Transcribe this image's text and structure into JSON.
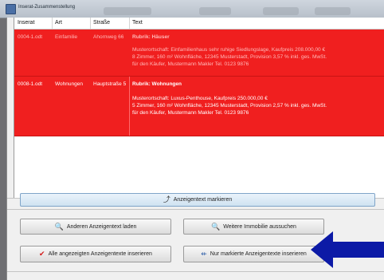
{
  "window": {
    "title": "Inserat-Zusammenstellung"
  },
  "grid": {
    "columns": [
      "Inserat",
      "Art",
      "Straße",
      "Text"
    ],
    "rows": [
      {
        "inserat": "0004-1.odt",
        "art": "Einfamilie",
        "strasse": "Ahornweg 66",
        "rubrik": "Rubrik: Häuser",
        "text_lines": [
          "Musterortschaft: Einfamilienhaus sehr ruhige Siedlungslage, Kaufpreis 208.000,00 €",
          "8 Zimmer, 160 m² Wohnfläche, 12345 Musterstadt, Provision 3,57 % inkl. ges. MwSt.",
          "für den Käufer, Mustermann Makler Tel. 0123 9876"
        ]
      },
      {
        "inserat": "0008-1.odt",
        "art": "Wohnungen",
        "strasse": "Hauptstraße 5",
        "rubrik": "Rubrik: Wohnungen",
        "text_lines": [
          "Musterortschaft: Luxus-Penthouse, Kaufpreis 250.000,00 €",
          "5 Zimmer, 160 m² Wohnfläche, 12345 Musterstadt, Provision 2,57 % inkl. ges. MwSt.",
          "für den Käufer, Mustermann Makler Tel. 0123 9876"
        ]
      }
    ]
  },
  "buttons": {
    "markieren": {
      "label": "Anzeigentext markieren",
      "icon": "mark-icon"
    },
    "laden": {
      "label": "Anderen Anzeigentext laden",
      "icon": "magnifier-icon"
    },
    "suchen": {
      "label": "Weitere Immobilie aussuchen",
      "icon": "magnifier-icon"
    },
    "alle": {
      "label": "Alle angezeigten Anzeigentexte inserieren",
      "icon": "checkmark-icon"
    },
    "markierte": {
      "label": "Nur markierte Anzeigentexte inserieren",
      "icon": "insert-icon"
    }
  },
  "colors": {
    "row_highlight": "#f01f1f",
    "annotation_arrow": "#0c1aa6"
  }
}
